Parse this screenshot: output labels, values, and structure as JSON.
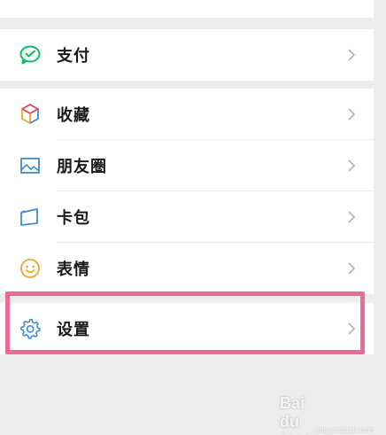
{
  "menu": {
    "pay": {
      "label": "支付",
      "icon": "wechat-pay-icon"
    },
    "favorites": {
      "label": "收藏",
      "icon": "cube-icon"
    },
    "moments": {
      "label": "朋友圈",
      "icon": "image-icon"
    },
    "cards": {
      "label": "卡包",
      "icon": "card-icon"
    },
    "stickers": {
      "label": "表情",
      "icon": "smiley-icon"
    },
    "settings": {
      "label": "设置",
      "icon": "gear-icon"
    }
  },
  "watermark": {
    "text": "Bai du 经验",
    "sub": "jingyan.baidu.com"
  },
  "colors": {
    "background": "#ededed",
    "highlight": "#ec6b95",
    "pay_icon": "#07c160",
    "blue_icon": "#3d8bd6",
    "smiley_icon": "#f5a623"
  }
}
